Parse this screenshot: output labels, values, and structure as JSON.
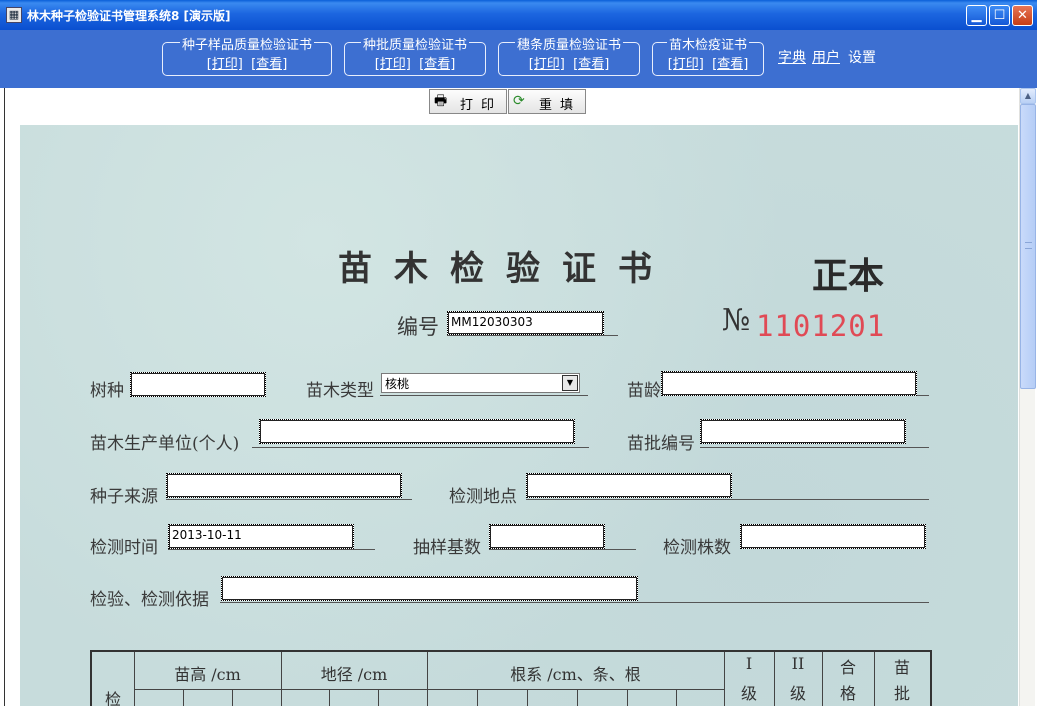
{
  "window": {
    "title": "林木种子检验证书管理系统8 [演示版]",
    "app_icon": "calculator-icon",
    "controls": [
      "minimize-icon",
      "maximize-icon",
      "close-icon"
    ]
  },
  "toolbar": {
    "groups": [
      {
        "title": "种子样品质量检验证书",
        "print": "[打印]",
        "view": "[查看]"
      },
      {
        "title": "种批质量检验证书",
        "print": "[打印]",
        "view": "[查看]"
      },
      {
        "title": "穗条质量检验证书",
        "print": "[打印]",
        "view": "[查看]"
      },
      {
        "title": "苗木检疫证书",
        "print": "[打印]",
        "view": "[查看]"
      }
    ],
    "links": {
      "dictionary": "字典",
      "user": "用户",
      "settings": "设置"
    }
  },
  "actions": {
    "print_label": "打印",
    "print_icon": "printer-icon",
    "reset_label": "重填",
    "reset_icon": "refresh-icon"
  },
  "certificate": {
    "title": "苗木检验证书",
    "copy_type": "正本",
    "number_label": "编号",
    "number_value": "MM12030303",
    "no_mark": "№",
    "serial": "1101201",
    "fields": {
      "species_label": "树种",
      "species_value": "",
      "seedling_type_label": "苗木类型",
      "seedling_type_value": "核桃",
      "age_label": "苗龄",
      "age_value": "",
      "producer_label": "苗木生产单位(个人)",
      "producer_value": "",
      "batch_no_label": "苗批编号",
      "batch_no_value": "",
      "seed_source_label": "种子来源",
      "seed_source_value": "",
      "test_site_label": "检测地点",
      "test_site_value": "",
      "test_time_label": "检测时间",
      "test_time_value": "2013-10-11",
      "sample_base_label": "抽样基数",
      "sample_base_value": "",
      "test_count_label": "检测株数",
      "test_count_value": "",
      "basis_label": "检验、检测依据",
      "basis_value": ""
    },
    "table": {
      "headers": [
        "苗高 /cm",
        "地径 /cm",
        "根系 /cm、条、根",
        "I",
        "II",
        "合",
        "苗"
      ],
      "headers_line2": [
        "级",
        "级",
        "格",
        "批"
      ],
      "first_col": "检"
    }
  }
}
